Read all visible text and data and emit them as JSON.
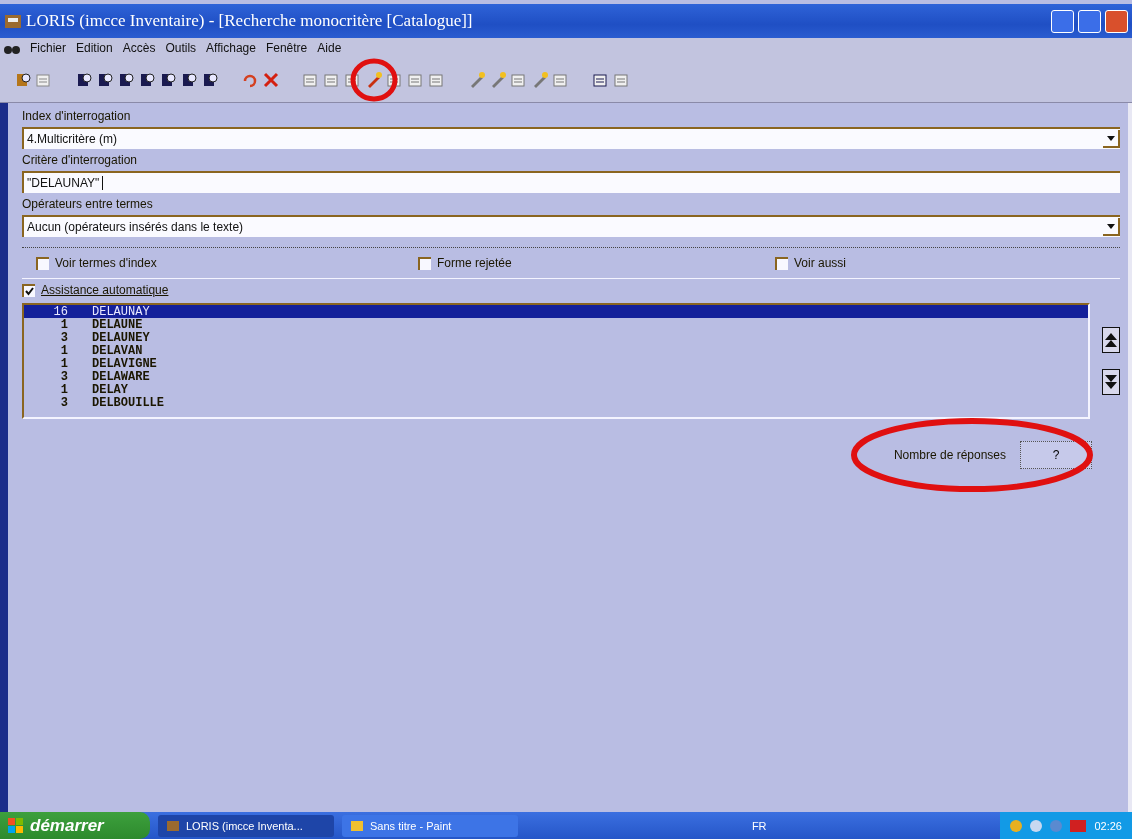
{
  "window": {
    "title": "LORIS (imcce Inventaire) - [Recherche monocritère [Catalogue]]"
  },
  "menu": [
    "Fichier",
    "Edition",
    "Accès",
    "Outils",
    "Affichage",
    "Fenêtre",
    "Aide"
  ],
  "form": {
    "index_label": "Index d'interrogation",
    "index_value": "4.Multicritère (m)",
    "criteria_label": "Critère d'interrogation",
    "criteria_value": "\"DELAUNAY\"",
    "operators_label": "Opérateurs entre termes",
    "operators_value": "Aucun (opérateurs insérés dans le texte)",
    "options": [
      {
        "label": "Voir termes d'index",
        "checked": false
      },
      {
        "label": "Forme rejetée",
        "checked": false
      },
      {
        "label": "Voir aussi",
        "checked": false
      }
    ],
    "assist": {
      "label": "Assistance automatique",
      "checked": true
    }
  },
  "results": [
    {
      "count": "16",
      "term": "DELAUNAY",
      "selected": true
    },
    {
      "count": "1",
      "term": "DELAUNE",
      "selected": false
    },
    {
      "count": "3",
      "term": "DELAUNEY",
      "selected": false
    },
    {
      "count": "1",
      "term": "DELAVAN",
      "selected": false
    },
    {
      "count": "1",
      "term": "DELAVIGNE",
      "selected": false
    },
    {
      "count": "3",
      "term": "DELAWARE",
      "selected": false
    },
    {
      "count": "1",
      "term": "DELAY",
      "selected": false
    },
    {
      "count": "3",
      "term": "DELBOUILLE",
      "selected": false
    }
  ],
  "answers": {
    "label": "Nombre de réponses",
    "value": "?"
  },
  "taskbar": {
    "start": "démarrer",
    "tasks": [
      {
        "label": "LORIS (imcce Inventa...",
        "selected": true
      },
      {
        "label": "Sans titre - Paint",
        "selected": false
      }
    ],
    "lang": "FR",
    "clock": "02:26"
  }
}
